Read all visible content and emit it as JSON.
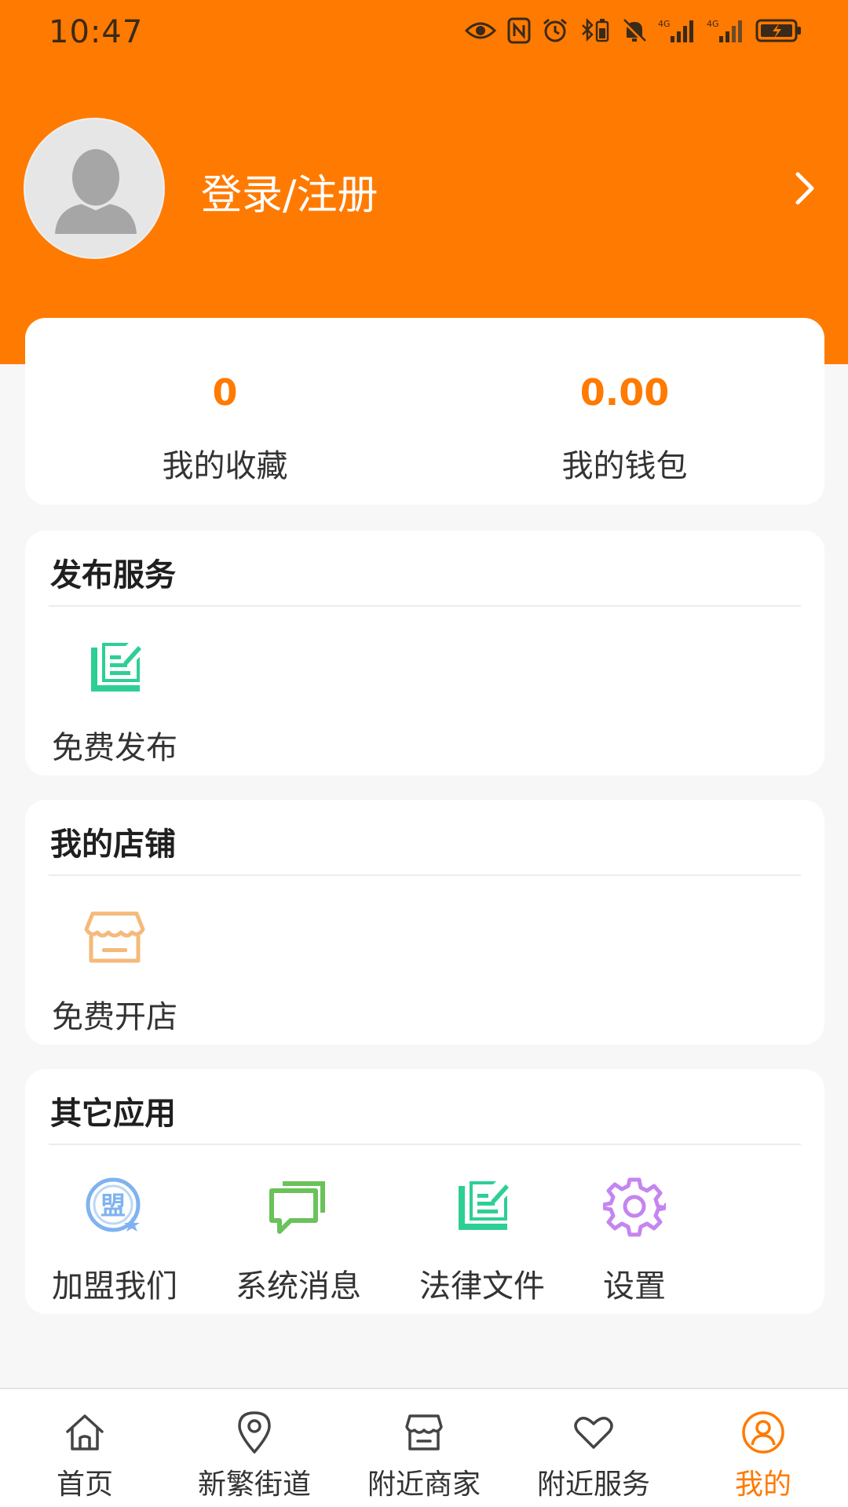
{
  "status_bar": {
    "time": "10:47"
  },
  "profile": {
    "login_text": "登录/注册"
  },
  "stats": [
    {
      "value": "0",
      "label": "我的收藏"
    },
    {
      "value": "0.00",
      "label": "我的钱包"
    }
  ],
  "sections": {
    "publish": {
      "title": "发布服务",
      "items": [
        {
          "label": "免费发布",
          "icon": "publish-document-icon"
        }
      ]
    },
    "shop": {
      "title": "我的店铺",
      "items": [
        {
          "label": "免费开店",
          "icon": "storefront-icon"
        }
      ]
    },
    "other": {
      "title": "其它应用",
      "items": [
        {
          "label": "加盟我们",
          "icon": "join-badge-icon"
        },
        {
          "label": "系统消息",
          "icon": "messages-icon"
        },
        {
          "label": "法律文件",
          "icon": "legal-document-icon"
        },
        {
          "label": "设置",
          "icon": "gear-icon"
        }
      ]
    }
  },
  "bottom_nav": [
    {
      "label": "首页",
      "icon": "home-icon"
    },
    {
      "label": "新繁街道",
      "icon": "location-pin-icon"
    },
    {
      "label": "附近商家",
      "icon": "store-icon"
    },
    {
      "label": "附近服务",
      "icon": "heart-icon"
    },
    {
      "label": "我的",
      "icon": "user-profile-icon",
      "active": true
    }
  ],
  "colors": {
    "brand": "#ff7a00",
    "green_icon": "#2ecf95",
    "shop_icon": "#f5b97a",
    "join_icon": "#7fb3f0",
    "message_icon": "#6ac25a",
    "gear_icon": "#c585f0"
  }
}
